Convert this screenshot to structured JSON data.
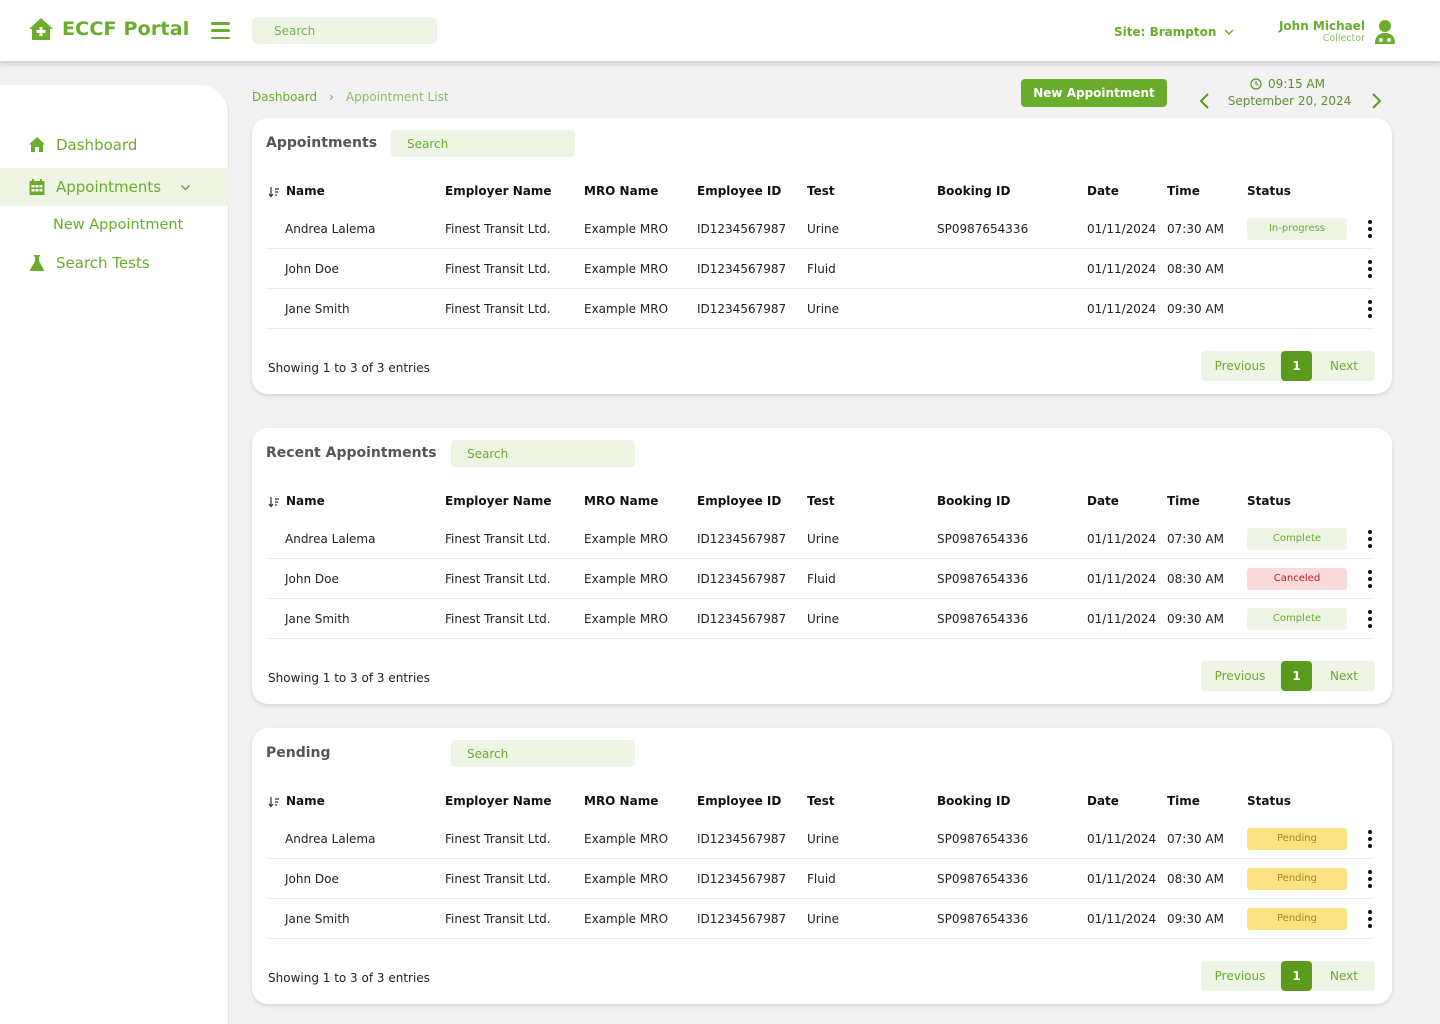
{
  "app": {
    "title": "ECCF Portal"
  },
  "header": {
    "search_placeholder": "Search",
    "site_label": "Site: Brampton",
    "user_name": "John Michael",
    "user_role": "Collector"
  },
  "sidebar": {
    "items": [
      {
        "label": "Dashboard",
        "icon": "home-icon"
      },
      {
        "label": "Appointments",
        "icon": "calendar-icon"
      },
      {
        "label": "New Appointment"
      },
      {
        "label": "Search Tests",
        "icon": "flask-icon"
      }
    ]
  },
  "breadcrumb": {
    "home": "Dashboard",
    "separator": "›",
    "current": "Appointment List"
  },
  "toolbar": {
    "new_appointment_label": "New Appointment",
    "time": "09:15 AM",
    "date": "September 20, 2024"
  },
  "columns": [
    "Name",
    "Employer Name",
    "MRO Name",
    "Employee ID",
    "Test",
    "Booking ID",
    "Date",
    "Time",
    "Status"
  ],
  "pagination": {
    "previous": "Previous",
    "page": "1",
    "next": "Next"
  },
  "cards": [
    {
      "title": "Appointments",
      "search_placeholder": "Search",
      "showing": "Showing 1 to 3 of 3 entries",
      "rows": [
        {
          "name": "Andrea Lalema",
          "employer": "Finest Transit Ltd.",
          "mro": "Example MRO",
          "employee_id": "ID1234567987",
          "test": "Urine",
          "booking_id": "SP0987654336",
          "date": "01/11/2024",
          "time": "07:30 AM",
          "status": "In-progress",
          "status_type": "inprogress"
        },
        {
          "name": "John Doe",
          "employer": "Finest Transit Ltd.",
          "mro": "Example MRO",
          "employee_id": "ID1234567987",
          "test": "Fluid",
          "booking_id": "",
          "date": "01/11/2024",
          "time": "08:30 AM",
          "status": "",
          "status_type": ""
        },
        {
          "name": "Jane Smith",
          "employer": "Finest Transit Ltd.",
          "mro": "Example MRO",
          "employee_id": "ID1234567987",
          "test": "Urine",
          "booking_id": "",
          "date": "01/11/2024",
          "time": "09:30 AM",
          "status": "",
          "status_type": ""
        }
      ]
    },
    {
      "title": "Recent Appointments",
      "search_placeholder": "Search",
      "showing": "Showing 1 to 3 of 3 entries",
      "rows": [
        {
          "name": "Andrea Lalema",
          "employer": "Finest Transit Ltd.",
          "mro": "Example MRO",
          "employee_id": "ID1234567987",
          "test": "Urine",
          "booking_id": "SP0987654336",
          "date": "01/11/2024",
          "time": "07:30 AM",
          "status": "Complete",
          "status_type": "complete"
        },
        {
          "name": "John Doe",
          "employer": "Finest Transit Ltd.",
          "mro": "Example MRO",
          "employee_id": "ID1234567987",
          "test": "Fluid",
          "booking_id": "SP0987654336",
          "date": "01/11/2024",
          "time": "08:30 AM",
          "status": "Canceled",
          "status_type": "canceled"
        },
        {
          "name": "Jane Smith",
          "employer": "Finest Transit Ltd.",
          "mro": "Example MRO",
          "employee_id": "ID1234567987",
          "test": "Urine",
          "booking_id": "SP0987654336",
          "date": "01/11/2024",
          "time": "09:30 AM",
          "status": "Complete",
          "status_type": "complete"
        }
      ]
    },
    {
      "title": "Pending",
      "search_placeholder": "Search",
      "showing": "Showing 1 to 3 of 3 entries",
      "rows": [
        {
          "name": "Andrea Lalema",
          "employer": "Finest Transit Ltd.",
          "mro": "Example MRO",
          "employee_id": "ID1234567987",
          "test": "Urine",
          "booking_id": "SP0987654336",
          "date": "01/11/2024",
          "time": "07:30 AM",
          "status": "Pending",
          "status_type": "pending"
        },
        {
          "name": "John Doe",
          "employer": "Finest Transit Ltd.",
          "mro": "Example MRO",
          "employee_id": "ID1234567987",
          "test": "Fluid",
          "booking_id": "SP0987654336",
          "date": "01/11/2024",
          "time": "08:30 AM",
          "status": "Pending",
          "status_type": "pending"
        },
        {
          "name": "Jane Smith",
          "employer": "Finest Transit Ltd.",
          "mro": "Example MRO",
          "employee_id": "ID1234567987",
          "test": "Urine",
          "booking_id": "SP0987654336",
          "date": "01/11/2024",
          "time": "09:30 AM",
          "status": "Pending",
          "status_type": "pending"
        }
      ]
    }
  ],
  "colors": {
    "brand": "#6aac2c",
    "brand_dark": "#5a9b1e",
    "tint": "#eef5e4",
    "canceled_bg": "#fbdada",
    "pending_bg": "#fbe283"
  }
}
